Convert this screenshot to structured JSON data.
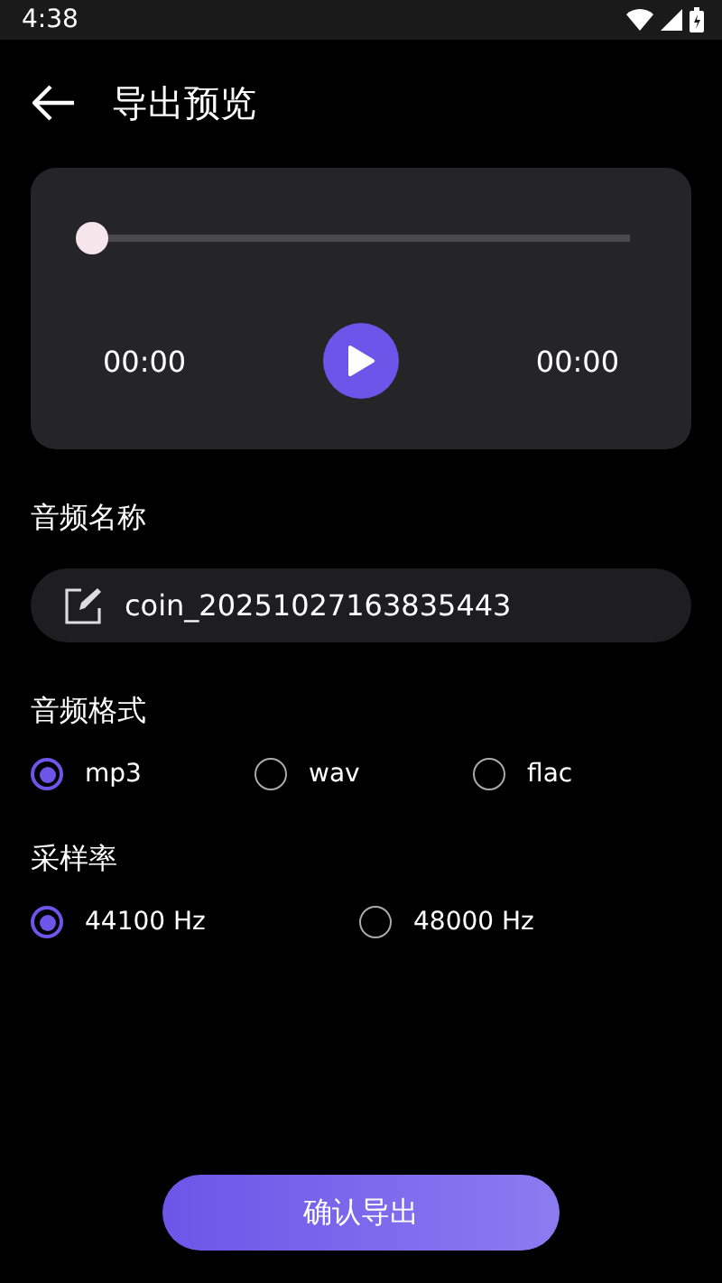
{
  "status_bar": {
    "time": "4:38"
  },
  "header": {
    "title": "导出预览"
  },
  "player": {
    "level": 0,
    "current_time": "00:00",
    "total_time": "00:00"
  },
  "name_section": {
    "label": "音频名称",
    "value": "coin_20251027163835443"
  },
  "format_section": {
    "label": "音频格式",
    "options": [
      {
        "label": "mp3",
        "selected": true
      },
      {
        "label": "wav",
        "selected": false
      },
      {
        "label": "flac",
        "selected": false
      }
    ]
  },
  "rate_section": {
    "label": "采样率",
    "options": [
      {
        "label": "44100 Hz",
        "selected": true
      },
      {
        "label": "48000 Hz",
        "selected": false
      }
    ]
  },
  "confirm_button": {
    "label": "确认导出"
  }
}
